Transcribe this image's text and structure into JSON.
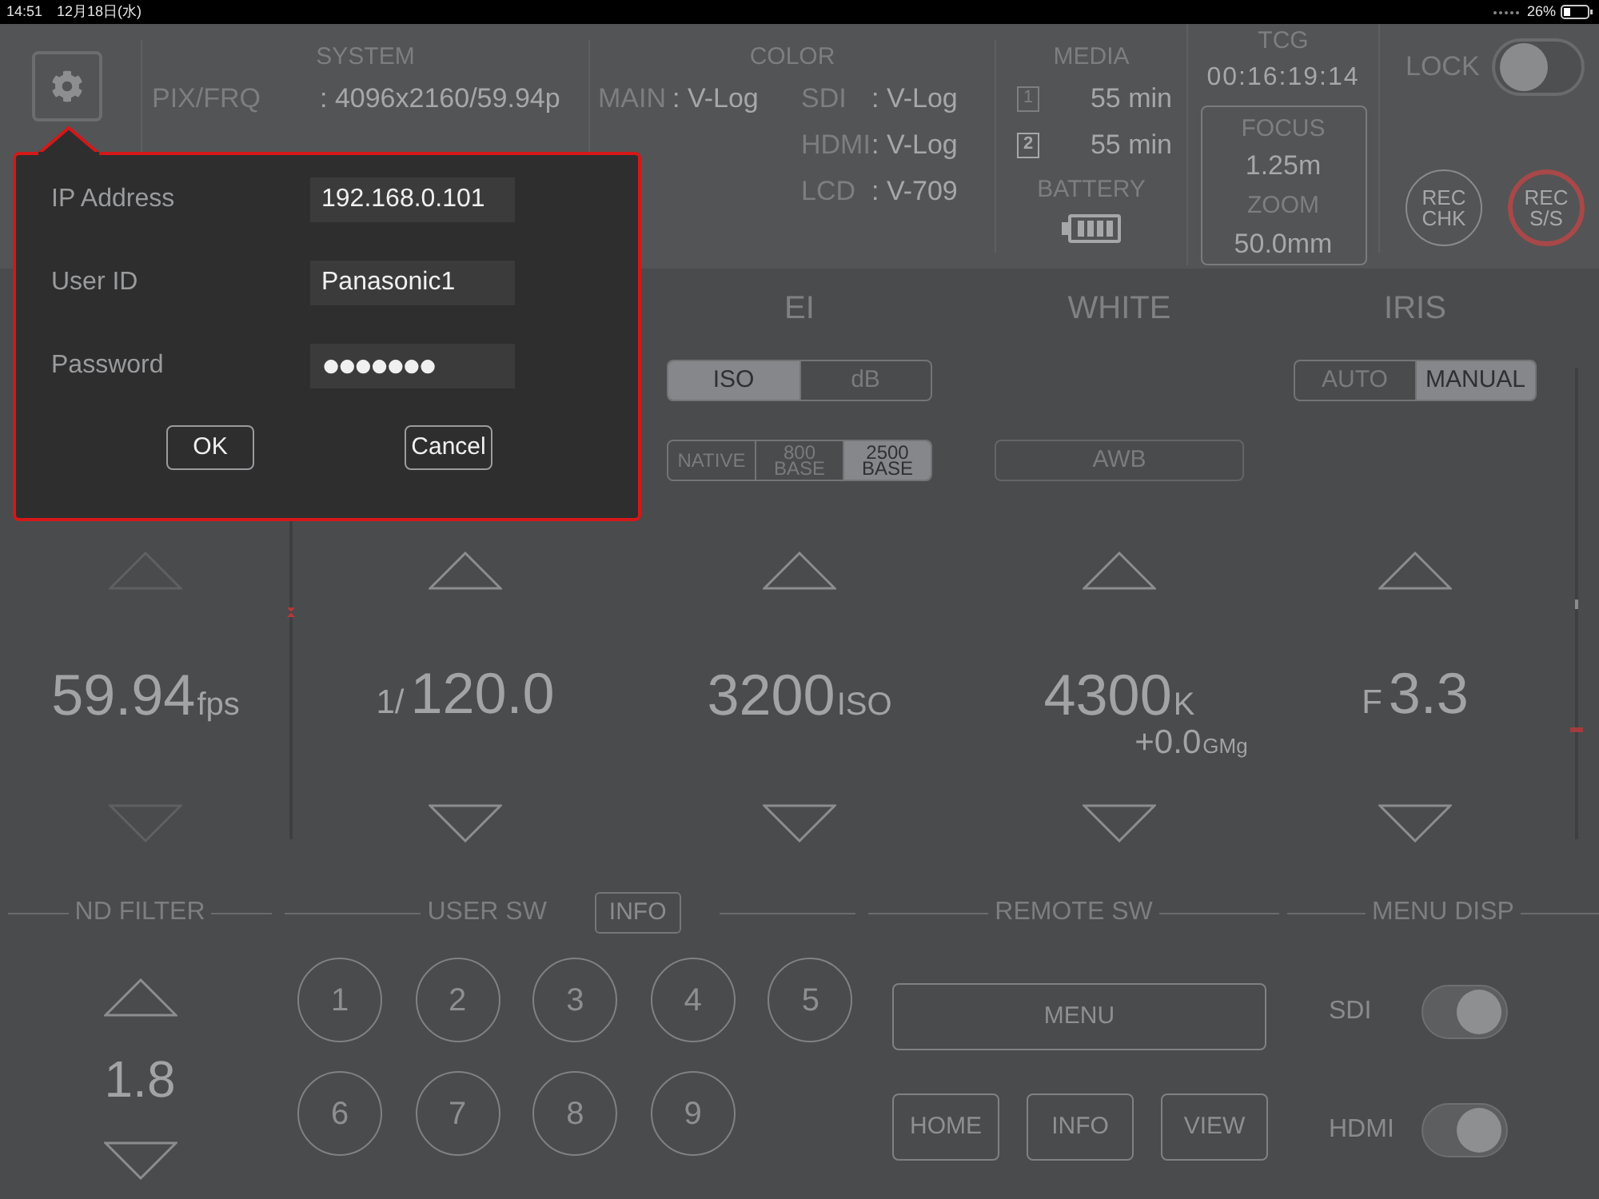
{
  "status_bar": {
    "time": "14:51",
    "date": "12月18日(水)",
    "battery": "26%"
  },
  "system": {
    "title": "SYSTEM",
    "rows": [
      {
        "label": "PIX/FRQ",
        "value": ": 4096x2160/59.94p"
      }
    ]
  },
  "color": {
    "title": "COLOR",
    "main": {
      "label": "MAIN",
      "value": ": V-Log"
    },
    "outputs": [
      {
        "label": "SDI",
        "value": ": V-Log"
      },
      {
        "label": "HDMI",
        "value": ": V-Log"
      },
      {
        "label": "LCD",
        "value": ": V-709"
      }
    ]
  },
  "media": {
    "title": "MEDIA",
    "slots": [
      {
        "slot": "1",
        "remaining": "55 min",
        "selected": false
      },
      {
        "slot": "2",
        "remaining": "55 min",
        "selected": true
      }
    ],
    "battery_label": "BATTERY"
  },
  "tcg": {
    "title": "TCG",
    "timecode": "00:16:19:14",
    "focus_label": "FOCUS",
    "focus": "1.25m",
    "zoom_label": "ZOOM",
    "zoom": "50.0mm"
  },
  "lock": {
    "label": "LOCK",
    "on": false
  },
  "rec_buttons": [
    {
      "lines": [
        "REC",
        "CHK"
      ],
      "kind": "check"
    },
    {
      "lines": [
        "REC",
        "S/S"
      ],
      "kind": "record"
    }
  ],
  "params": [
    {
      "kind": "fps",
      "value": "59.94",
      "unit": "fps",
      "arrows_disabled": true
    },
    {
      "kind": "shutter",
      "prefix": "1/",
      "value": "120.0",
      "arrows_disabled": false
    },
    {
      "kind": "ei",
      "title": "EI",
      "value": "3200",
      "unit": "ISO",
      "arrows_disabled": false,
      "mode_switch": [
        {
          "label": "ISO",
          "selected": true
        },
        {
          "label": "dB",
          "selected": false
        }
      ],
      "base_switch": [
        {
          "label": "NATIVE",
          "selected": false
        },
        {
          "label": "800 BASE",
          "selected": false
        },
        {
          "label": "2500 BASE",
          "selected": true
        }
      ]
    },
    {
      "kind": "white",
      "title": "WHITE",
      "value": "4300",
      "unit": "K",
      "sub_value": "+0.0",
      "sub_unit": "GMg",
      "button": "AWB",
      "arrows_disabled": false
    },
    {
      "kind": "iris",
      "title": "IRIS",
      "prefix": "F",
      "value": "3.3",
      "arrows_disabled": false,
      "mode_switch": [
        {
          "label": "AUTO",
          "selected": false
        },
        {
          "label": "MANUAL",
          "selected": true
        }
      ]
    }
  ],
  "nd_filter": {
    "title": "ND FILTER",
    "value": "1.8"
  },
  "user_sw": {
    "title": "USER SW",
    "info_button": "INFO",
    "buttons": [
      "1",
      "2",
      "3",
      "4",
      "5",
      "6",
      "7",
      "8",
      "9"
    ]
  },
  "remote_sw": {
    "title": "REMOTE SW",
    "menu_button": "MENU",
    "buttons": [
      "HOME",
      "INFO",
      "VIEW"
    ]
  },
  "menu_disp": {
    "title": "MENU DISP",
    "toggles": [
      {
        "label": "SDI",
        "on": true
      },
      {
        "label": "HDMI",
        "on": true
      }
    ]
  },
  "dialog": {
    "fields": [
      {
        "label": "IP Address",
        "value": "192.168.0.101",
        "kind": "text"
      },
      {
        "label": "User ID",
        "value": "Panasonic1",
        "kind": "text"
      },
      {
        "label": "Password",
        "value": "●●●●●●●",
        "kind": "password"
      }
    ],
    "buttons": [
      "OK",
      "Cancel"
    ]
  }
}
